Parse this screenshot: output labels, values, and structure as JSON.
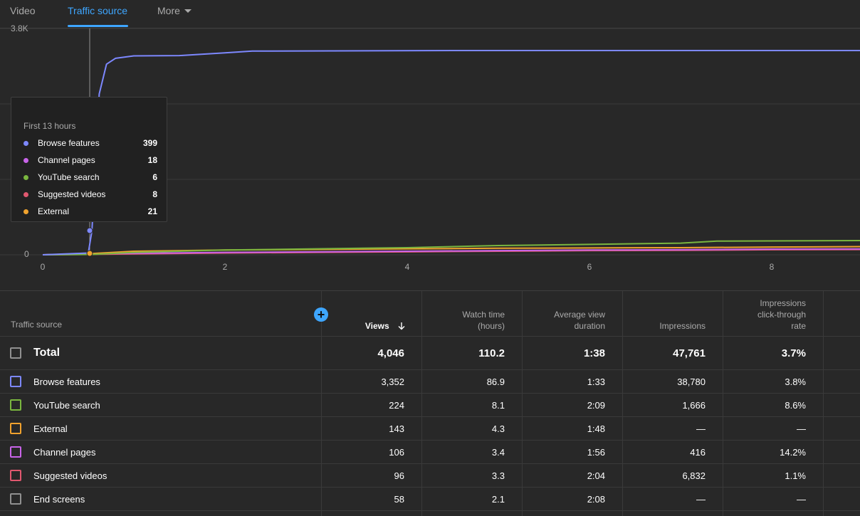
{
  "tabs": {
    "video": "Video",
    "traffic_source": "Traffic source",
    "more": "More"
  },
  "chart": {
    "y_top_label": "3.8K",
    "y_zero_label": "0",
    "x_ticks": [
      "0",
      "2",
      "4",
      "6",
      "8"
    ]
  },
  "chart_data": {
    "type": "line",
    "xlim": [
      0,
      9.3
    ],
    "ylim": [
      0,
      3800
    ],
    "grid": true,
    "xticks": [
      0,
      2,
      4,
      6,
      8
    ],
    "series": [
      {
        "name": "Browse features",
        "color": "#7d88ff",
        "points": [
          [
            0,
            0
          ],
          [
            0.5,
            30
          ],
          [
            0.54,
            399
          ],
          [
            0.62,
            2700
          ],
          [
            0.7,
            3200
          ],
          [
            0.8,
            3300
          ],
          [
            1.0,
            3340
          ],
          [
            1.5,
            3345
          ],
          [
            2.0,
            3390
          ],
          [
            2.3,
            3420
          ],
          [
            4.5,
            3430
          ],
          [
            9.3,
            3430
          ]
        ]
      },
      {
        "name": "YouTube search",
        "color": "#7ab63f",
        "points": [
          [
            0,
            0
          ],
          [
            0.54,
            6
          ],
          [
            1,
            40
          ],
          [
            2,
            80
          ],
          [
            3,
            100
          ],
          [
            4,
            120
          ],
          [
            5,
            155
          ],
          [
            6,
            175
          ],
          [
            7,
            195
          ],
          [
            7.4,
            230
          ],
          [
            9.3,
            240
          ]
        ]
      },
      {
        "name": "External",
        "color": "#f0a22e",
        "points": [
          [
            0,
            0
          ],
          [
            0.54,
            21
          ],
          [
            1,
            60
          ],
          [
            2,
            80
          ],
          [
            3,
            90
          ],
          [
            4,
            100
          ],
          [
            5,
            110
          ],
          [
            6,
            115
          ],
          [
            7,
            120
          ],
          [
            8,
            130
          ],
          [
            9.3,
            140
          ]
        ]
      },
      {
        "name": "Channel pages",
        "color": "#c864e8",
        "points": [
          [
            0,
            0
          ],
          [
            0.54,
            18
          ],
          [
            1,
            25
          ],
          [
            2,
            40
          ],
          [
            3,
            50
          ],
          [
            4,
            60
          ],
          [
            5,
            70
          ],
          [
            6,
            80
          ],
          [
            7,
            85
          ],
          [
            8,
            95
          ],
          [
            9.3,
            100
          ]
        ]
      },
      {
        "name": "Suggested videos",
        "color": "#e0586f",
        "points": [
          [
            0,
            0
          ],
          [
            0.54,
            8
          ],
          [
            1,
            15
          ],
          [
            2,
            30
          ],
          [
            3,
            40
          ],
          [
            4,
            50
          ],
          [
            5,
            60
          ],
          [
            6,
            70
          ],
          [
            7,
            75
          ],
          [
            8,
            85
          ],
          [
            9.3,
            90
          ]
        ]
      }
    ]
  },
  "tooltip": {
    "title": "First 13 hours",
    "rows": [
      {
        "label": "Browse features",
        "value": "399",
        "color": "#7d88ff"
      },
      {
        "label": "Channel pages",
        "value": "18",
        "color": "#c864e8"
      },
      {
        "label": "YouTube search",
        "value": "6",
        "color": "#7ab63f"
      },
      {
        "label": "Suggested videos",
        "value": "8",
        "color": "#e0586f"
      },
      {
        "label": "External",
        "value": "21",
        "color": "#f0a22e"
      }
    ]
  },
  "table": {
    "headers": {
      "name": "Traffic source",
      "views": "Views",
      "watch_time_1": "Watch time",
      "watch_time_2": "(hours)",
      "avd_1": "Average view",
      "avd_2": "duration",
      "impressions": "Impressions",
      "ctr_1": "Impressions",
      "ctr_2": "click-through",
      "ctr_3": "rate"
    },
    "sort_icon": "arrow-down-icon",
    "add_icon": "+",
    "total": {
      "name": "Total",
      "views": "4,046",
      "watch": "110.2",
      "avd": "1:38",
      "impressions": "47,761",
      "ctr": "3.7%"
    },
    "rows": [
      {
        "name": "Browse features",
        "views": "3,352",
        "watch": "86.9",
        "avd": "1:33",
        "impressions": "38,780",
        "ctr": "3.8%",
        "color": "#7d88ff"
      },
      {
        "name": "YouTube search",
        "views": "224",
        "watch": "8.1",
        "avd": "2:09",
        "impressions": "1,666",
        "ctr": "8.6%",
        "color": "#7ab63f"
      },
      {
        "name": "External",
        "views": "143",
        "watch": "4.3",
        "avd": "1:48",
        "impressions": "—",
        "ctr": "—",
        "color": "#f0a22e"
      },
      {
        "name": "Channel pages",
        "views": "106",
        "watch": "3.4",
        "avd": "1:56",
        "impressions": "416",
        "ctr": "14.2%",
        "color": "#c864e8"
      },
      {
        "name": "Suggested videos",
        "views": "96",
        "watch": "3.3",
        "avd": "2:04",
        "impressions": "6,832",
        "ctr": "1.1%",
        "color": "#e0586f"
      },
      {
        "name": "End screens",
        "views": "58",
        "watch": "2.1",
        "avd": "2:08",
        "impressions": "—",
        "ctr": "—",
        "color": "#909090"
      }
    ]
  }
}
